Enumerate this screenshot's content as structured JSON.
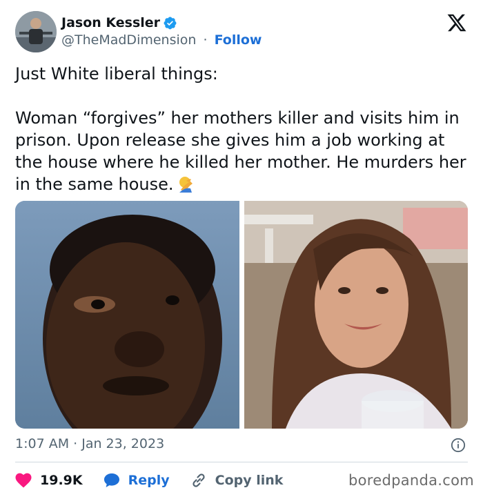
{
  "author": {
    "name": "Jason Kessler",
    "handle": "@TheMadDimension",
    "separator": "·",
    "follow_label": "Follow",
    "verified": true
  },
  "tweet": {
    "line1": "Just White liberal things:",
    "body": "Woman “forgives” her mothers killer and visits him in prison. Upon release she gives him a job working at the house where he killed her mother. He murders her in the same house.",
    "emoji": "facepalm-icon"
  },
  "media": {
    "count": 2
  },
  "meta": {
    "timestamp": "1:07 AM · Jan 23, 2023"
  },
  "actions": {
    "likes": "19.9K",
    "reply_label": "Reply",
    "copy_link_label": "Copy link"
  },
  "watermark": "boredpanda.com",
  "colors": {
    "link_blue": "#1d6fd6",
    "heart_red": "#f91880",
    "muted": "#536471",
    "text": "#0f1419"
  }
}
